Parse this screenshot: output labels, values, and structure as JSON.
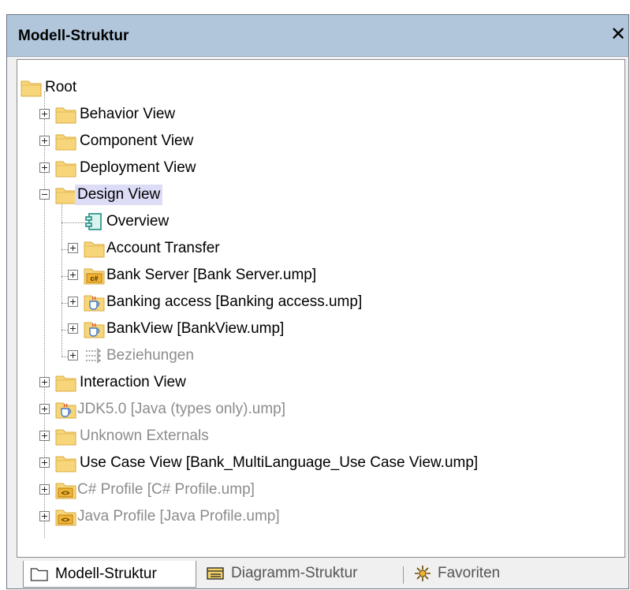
{
  "panel": {
    "title": "Modell-Struktur",
    "close_symbol": "✕"
  },
  "tree": {
    "root": {
      "label": "Root",
      "icon": "folder"
    },
    "items": [
      {
        "label": "Behavior View",
        "icon": "folder",
        "expander": "plus"
      },
      {
        "label": "Component View",
        "icon": "folder",
        "expander": "plus"
      },
      {
        "label": "Deployment View",
        "icon": "folder",
        "expander": "plus"
      },
      {
        "label": "Design View",
        "icon": "folder",
        "expander": "minus",
        "selected": true,
        "children": [
          {
            "label": "Overview",
            "icon": "component-diagram"
          },
          {
            "label": "Account Transfer",
            "icon": "folder",
            "expander": "plus"
          },
          {
            "label": "Bank Server [Bank Server.ump]",
            "icon": "csharp-package",
            "expander": "plus"
          },
          {
            "label": "Banking access [Banking access.ump]",
            "icon": "java-package",
            "expander": "plus"
          },
          {
            "label": "BankView [BankView.ump]",
            "icon": "java-package",
            "expander": "plus"
          },
          {
            "label": "Beziehungen",
            "icon": "relations",
            "expander": "plus",
            "gray": true
          }
        ]
      },
      {
        "label": "Interaction View",
        "icon": "folder",
        "expander": "plus"
      },
      {
        "label": "JDK5.0 [Java (types only).ump]",
        "icon": "java-package",
        "expander": "plus",
        "gray": true
      },
      {
        "label": "Unknown Externals",
        "icon": "folder",
        "expander": "plus",
        "gray": true
      },
      {
        "label": "Use Case View [Bank_MultiLanguage_Use Case View.ump]",
        "icon": "folder",
        "expander": "plus"
      },
      {
        "label": "C# Profile [C# Profile.ump]",
        "icon": "profile-package",
        "expander": "plus",
        "gray": true
      },
      {
        "label": "Java Profile [Java Profile.ump]",
        "icon": "profile-package",
        "expander": "plus",
        "gray": true
      }
    ]
  },
  "tabs": [
    {
      "label": "Modell-Struktur",
      "icon": "folder-outline-icon",
      "active": true
    },
    {
      "label": "Diagramm-Struktur",
      "icon": "diagram-tree-icon",
      "active": false
    },
    {
      "label": "Favoriten",
      "icon": "favorites-icon",
      "active": false
    }
  ],
  "colors": {
    "titlebar": "#b1c6db",
    "selection": "#dcdcf6",
    "folder": "#f7d67b",
    "disabled_text": "#8c8c8c"
  }
}
